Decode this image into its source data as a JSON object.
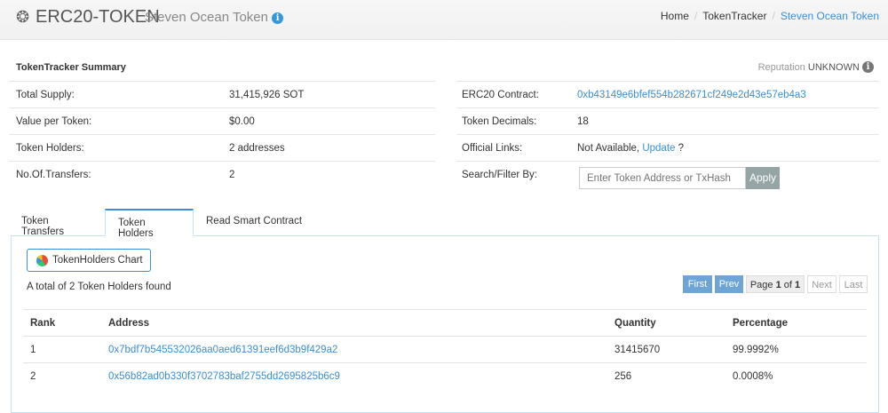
{
  "header": {
    "title": "ERC20-TOKEN",
    "subtitle": "Steven Ocean Token",
    "breadcrumb": [
      "Home",
      "TokenTracker",
      "Steven Ocean Token"
    ]
  },
  "summary": {
    "title": "TokenTracker Summary",
    "reputation_label": "Reputation",
    "reputation_value": "UNKNOWN",
    "left": [
      {
        "k": "Total Supply:",
        "v": "31,415,926 SOT"
      },
      {
        "k": "Value per Token:",
        "v": "$0.00"
      },
      {
        "k": "Token Holders:",
        "v": "2 addresses"
      },
      {
        "k": "No.Of.Transfers:",
        "v": "2"
      }
    ],
    "contract_label": "ERC20 Contract:",
    "contract": "0xb43149e6bfef554b282671cf249e2d43e57eb4a3",
    "decimals_label": "Token Decimals:",
    "decimals": "18",
    "links_label": "Official Links:",
    "links_value": "Not Available,",
    "links_update": "Update",
    "links_q": "?",
    "search_label": "Search/Filter By:",
    "search_placeholder": "Enter Token Address or TxHash",
    "apply": "Apply"
  },
  "tabs": [
    "Token Transfers",
    "Token Holders",
    "Read Smart Contract"
  ],
  "holders": {
    "chart_button": "TokenHolders Chart",
    "total": "A total of 2 Token Holders found",
    "pagination": {
      "first": "First",
      "prev": "Prev",
      "page_prefix": "Page",
      "page": "1",
      "of": "of",
      "pages": "1",
      "next": "Next",
      "last": "Last"
    },
    "columns": [
      "Rank",
      "Address",
      "Quantity",
      "Percentage"
    ],
    "rows": [
      {
        "rank": "1",
        "address": "0x7bdf7b545532026aa0aed61391eef6d3b9f429a2",
        "quantity": "31415670",
        "percentage": "99.9992%"
      },
      {
        "rank": "2",
        "address": "0x56b82ad0b330f3702783baf2755dd2695825b6c9",
        "quantity": "256",
        "percentage": "0.0008%"
      }
    ]
  }
}
